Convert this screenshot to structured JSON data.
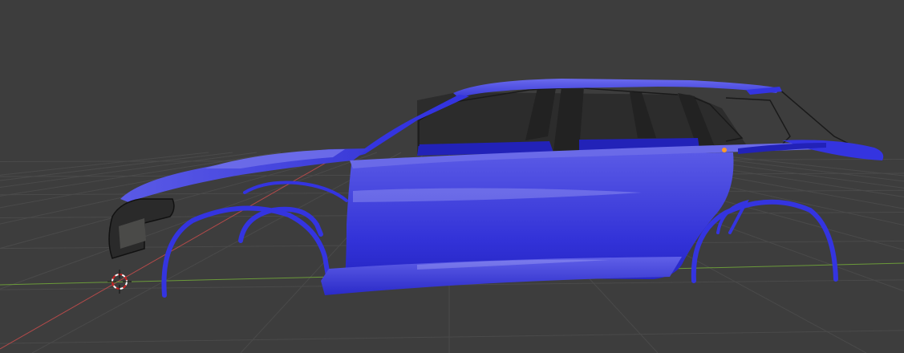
{
  "viewport": {
    "mode": "3d-viewport",
    "shading": "solid",
    "background_color": "#3d3d3d",
    "grid_line_color": "#4a4a4a",
    "x_axis_color": "#b54a4a",
    "y_axis_color": "#6b9a3a",
    "grid_floor": true
  },
  "scene": {
    "object": {
      "type": "car-body-mesh",
      "body_type": "station-wagon",
      "material_color": "#3434e0",
      "material_color_dark": "#2222b8",
      "material_highlight": "#6a6ae8",
      "interior_color": "#2c2c2c",
      "glass_frame_color": "#1a1a1a",
      "selected_origin_color": "#ff9a2a"
    },
    "cursor": {
      "icon": "3d-cursor-icon",
      "ring_color_a": "#ffffff",
      "ring_color_b": "#cc2222"
    }
  }
}
